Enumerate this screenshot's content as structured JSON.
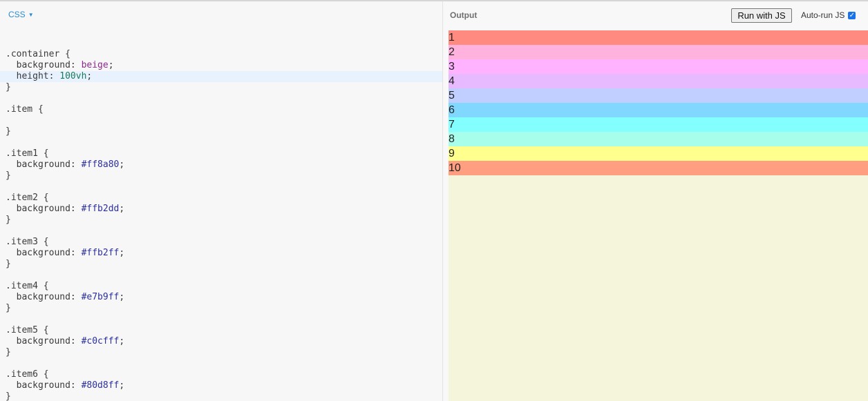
{
  "editor": {
    "language": "CSS",
    "lines": [
      [],
      [
        {
          "t": ".container {",
          "c": "sel"
        }
      ],
      [
        {
          "t": "  background: ",
          "c": "prop"
        },
        {
          "t": "beige",
          "c": "kw"
        },
        {
          "t": ";",
          "c": "prop"
        }
      ],
      [
        {
          "t": "  height: ",
          "c": "prop"
        },
        {
          "t": "100",
          "c": "num"
        },
        {
          "t": "vh",
          "c": "unit"
        },
        {
          "t": ";",
          "c": "prop"
        }
      ],
      [
        {
          "t": "}",
          "c": "sel"
        }
      ],
      [],
      [
        {
          "t": ".item {",
          "c": "sel"
        }
      ],
      [],
      [
        {
          "t": "}",
          "c": "sel"
        }
      ],
      [],
      [
        {
          "t": ".item1 {",
          "c": "sel"
        }
      ],
      [
        {
          "t": "  background: ",
          "c": "prop"
        },
        {
          "t": "#ff8a80",
          "c": "hex"
        },
        {
          "t": ";",
          "c": "prop"
        }
      ],
      [
        {
          "t": "}",
          "c": "sel"
        }
      ],
      [],
      [
        {
          "t": ".item2 {",
          "c": "sel"
        }
      ],
      [
        {
          "t": "  background: ",
          "c": "prop"
        },
        {
          "t": "#ffb2dd",
          "c": "hex"
        },
        {
          "t": ";",
          "c": "prop"
        }
      ],
      [
        {
          "t": "}",
          "c": "sel"
        }
      ],
      [],
      [
        {
          "t": ".item3 {",
          "c": "sel"
        }
      ],
      [
        {
          "t": "  background: ",
          "c": "prop"
        },
        {
          "t": "#ffb2ff",
          "c": "hex"
        },
        {
          "t": ";",
          "c": "prop"
        }
      ],
      [
        {
          "t": "}",
          "c": "sel"
        }
      ],
      [],
      [
        {
          "t": ".item4 {",
          "c": "sel"
        }
      ],
      [
        {
          "t": "  background: ",
          "c": "prop"
        },
        {
          "t": "#e7b9ff",
          "c": "hex"
        },
        {
          "t": ";",
          "c": "prop"
        }
      ],
      [
        {
          "t": "}",
          "c": "sel"
        }
      ],
      [],
      [
        {
          "t": ".item5 {",
          "c": "sel"
        }
      ],
      [
        {
          "t": "  background: ",
          "c": "prop"
        },
        {
          "t": "#c0cfff",
          "c": "hex"
        },
        {
          "t": ";",
          "c": "prop"
        }
      ],
      [
        {
          "t": "}",
          "c": "sel"
        }
      ],
      [],
      [
        {
          "t": ".item6 {",
          "c": "sel"
        }
      ],
      [
        {
          "t": "  background: ",
          "c": "prop"
        },
        {
          "t": "#80d8ff",
          "c": "hex"
        },
        {
          "t": ";",
          "c": "prop"
        }
      ],
      [
        {
          "t": "}",
          "c": "sel"
        }
      ]
    ],
    "active_line": 3
  },
  "output": {
    "title": "Output",
    "run_button": "Run with JS",
    "autorun_label": "Auto-run JS",
    "autorun_checked": true,
    "container_color": "#f5f5dc",
    "items": [
      {
        "label": "1",
        "color": "#ff8a80"
      },
      {
        "label": "2",
        "color": "#ffb2dd"
      },
      {
        "label": "3",
        "color": "#ffb2ff"
      },
      {
        "label": "4",
        "color": "#e7b9ff"
      },
      {
        "label": "5",
        "color": "#c0cfff"
      },
      {
        "label": "6",
        "color": "#80d8ff"
      },
      {
        "label": "7",
        "color": "#84ffff"
      },
      {
        "label": "8",
        "color": "#a7ffeb"
      },
      {
        "label": "9",
        "color": "#ffff8d"
      },
      {
        "label": "10",
        "color": "#ff9e80"
      }
    ]
  }
}
